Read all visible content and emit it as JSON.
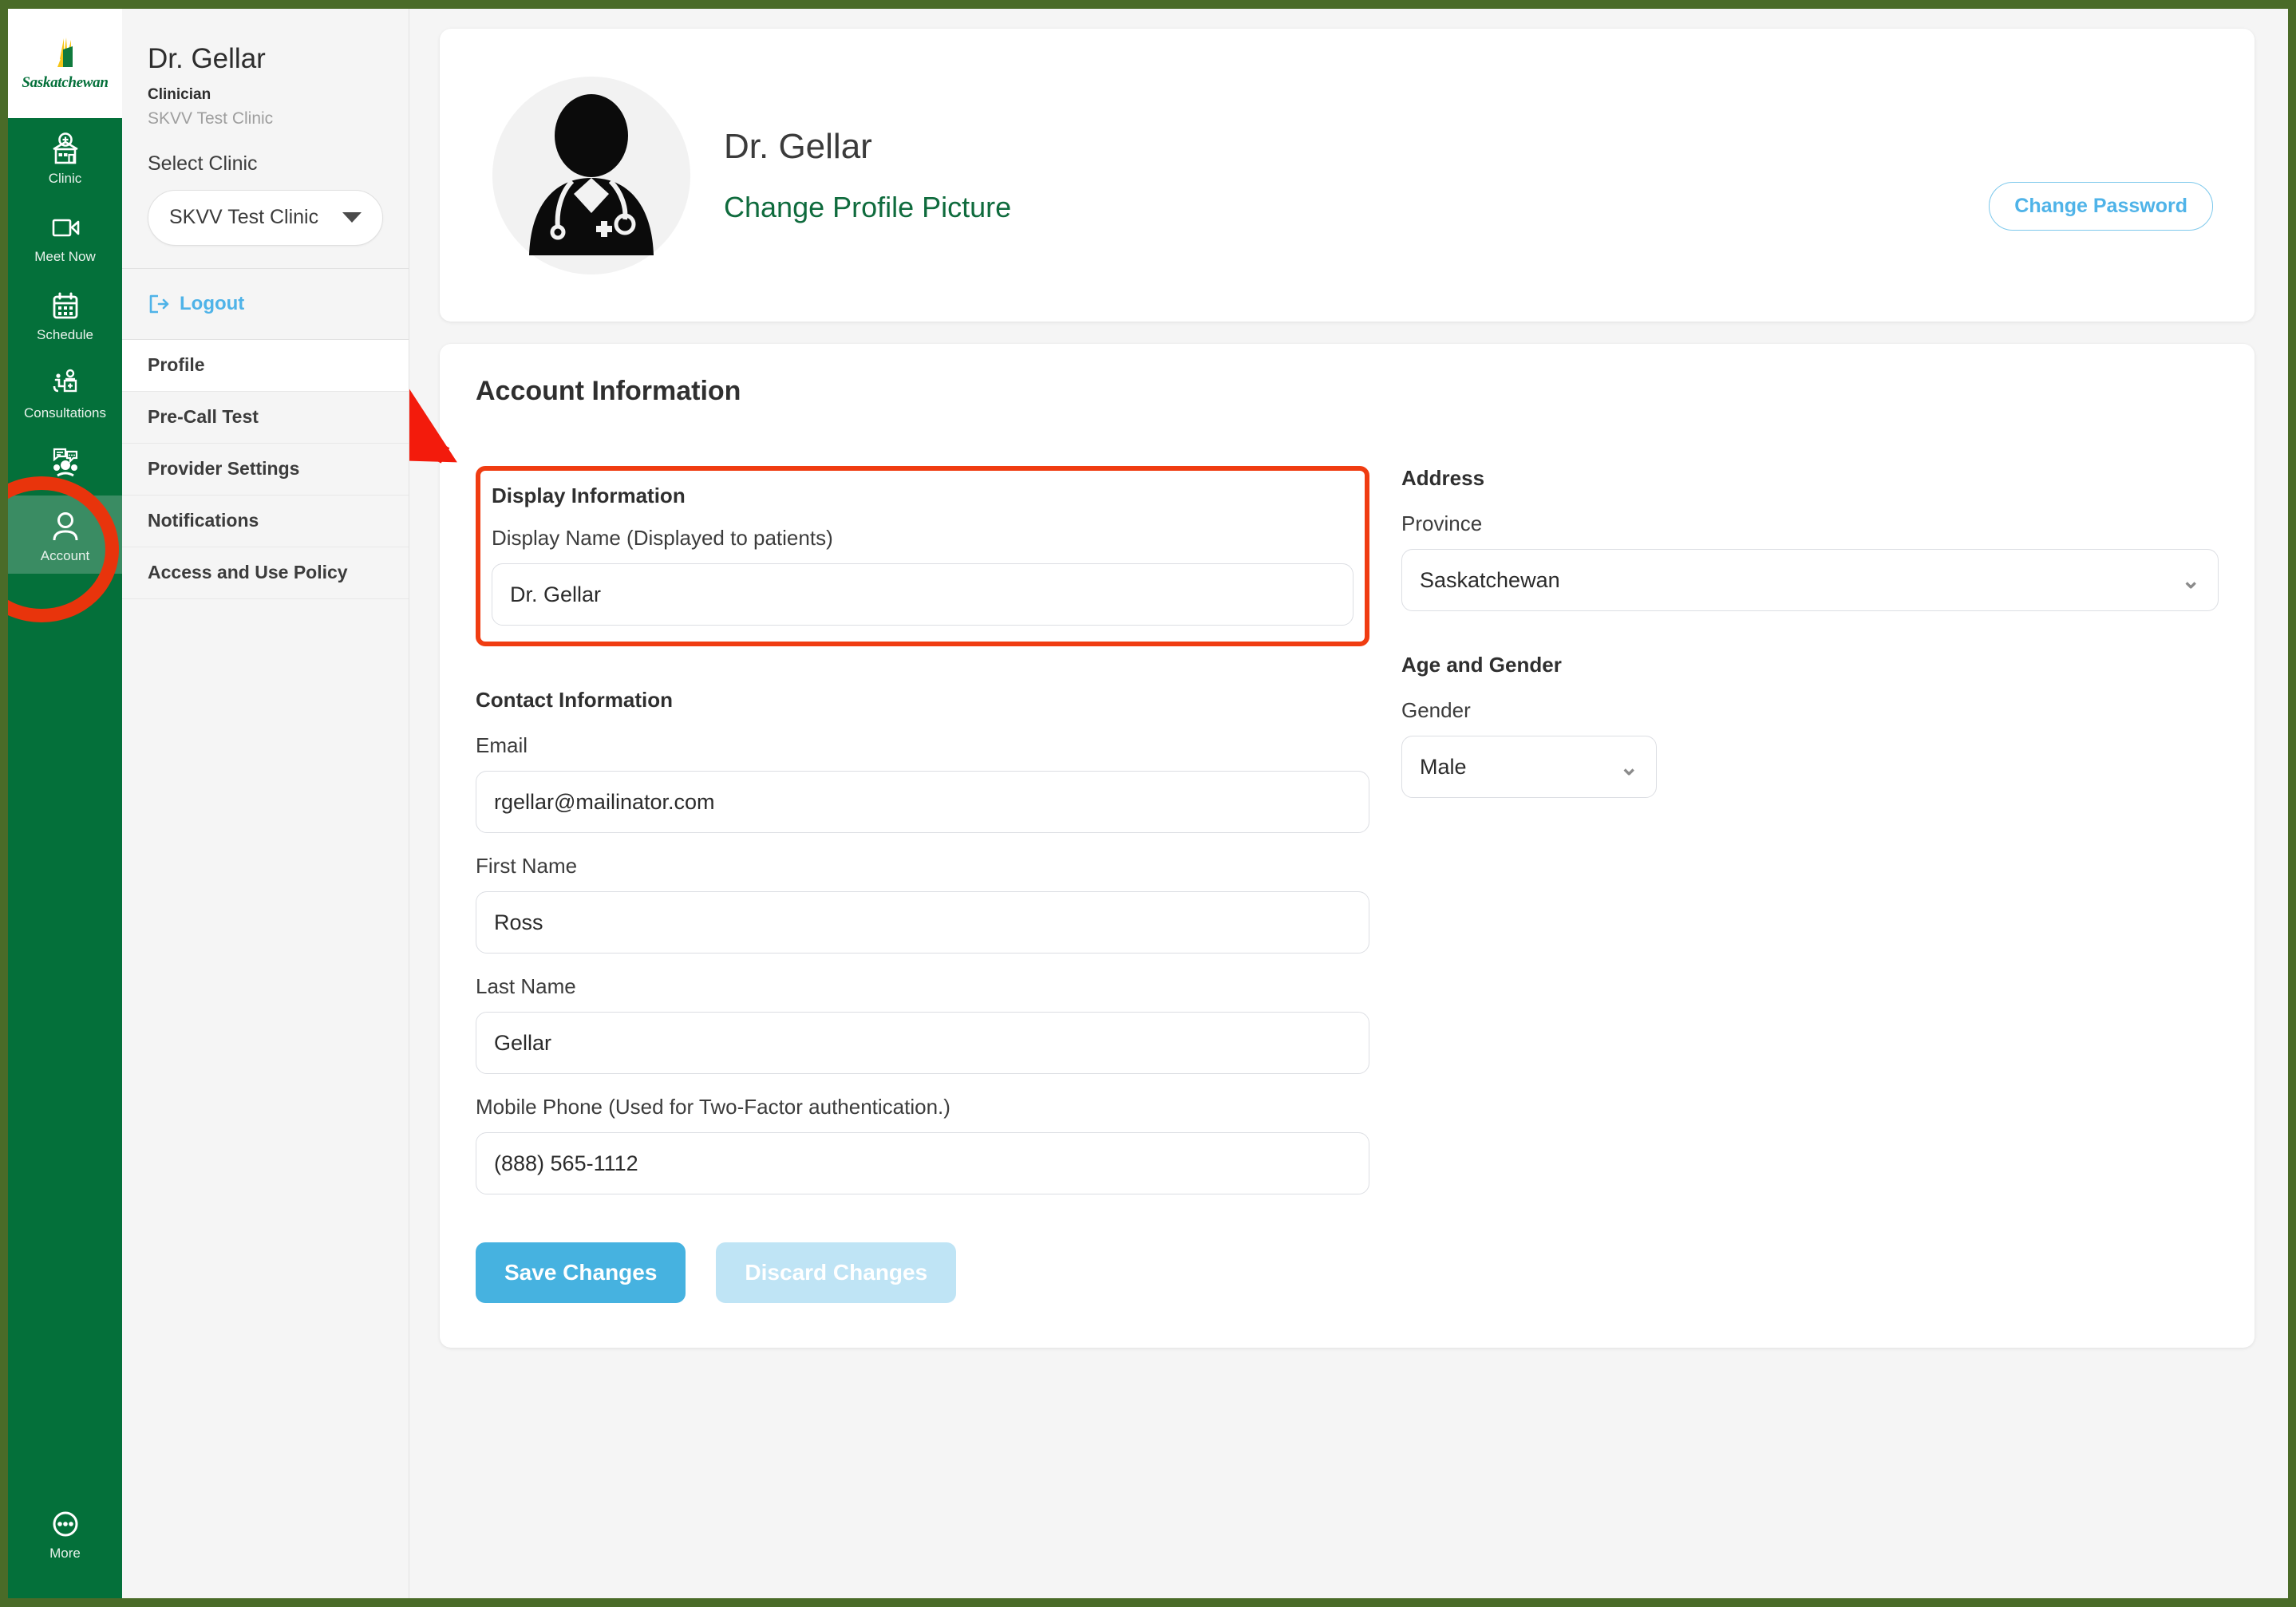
{
  "window": {
    "border_color": "#4a6b28",
    "page_bg": "#f5f5f5"
  },
  "brand": {
    "logo_word": "Saskatchewan",
    "green": "#04703a",
    "logo_icon": "saskatchewan-wheat-logo"
  },
  "rail": {
    "items": [
      {
        "label": "Clinic",
        "icon": "clinic-building-icon",
        "active": false
      },
      {
        "label": "Meet Now",
        "icon": "video-camera-icon",
        "active": false
      },
      {
        "label": "Schedule",
        "icon": "calendar-icon",
        "active": false
      },
      {
        "label": "Consultations",
        "icon": "consultation-desk-icon",
        "active": false
      },
      {
        "label": "",
        "icon": "group-chat-icon",
        "active": false
      },
      {
        "label": "Account",
        "icon": "user-person-icon",
        "active": true
      }
    ],
    "bottom": {
      "label": "More",
      "icon": "more-ellipsis-icon"
    }
  },
  "subnav": {
    "account_name": "Dr. Gellar",
    "role": "Clinician",
    "clinic": "SKVV Test Clinic",
    "select_clinic_label": "Select Clinic",
    "clinic_selected": "SKVV Test Clinic",
    "clinic_options": [
      "SKVV Test Clinic"
    ],
    "logout_label": "Logout",
    "logout_icon": "logout-arrow-icon",
    "menu": [
      {
        "label": "Profile",
        "current": true
      },
      {
        "label": "Pre-Call Test",
        "current": false
      },
      {
        "label": "Provider Settings",
        "current": false
      },
      {
        "label": "Notifications",
        "current": false
      },
      {
        "label": "Access and Use Policy",
        "current": false
      }
    ]
  },
  "profile_card": {
    "name": "Dr. Gellar",
    "change_picture_label": "Change Profile Picture",
    "change_picture_color": "#0f6b3d",
    "avatar_icon": "doctor-avatar-icon",
    "change_password_label": "Change Password",
    "change_password_color": "#4fb3e8"
  },
  "account_information": {
    "title": "Account Information",
    "display_information": {
      "heading": "Display Information",
      "display_name_label": "Display Name (Displayed to patients)",
      "display_name_value": "Dr. Gellar",
      "highlight_color": "#f03c11"
    },
    "address": {
      "heading": "Address",
      "province_label": "Province",
      "province_value": "Saskatchewan",
      "province_options": [
        "Saskatchewan"
      ]
    },
    "contact_information": {
      "heading": "Contact Information",
      "email_label": "Email",
      "email_value": "rgellar@mailinator.com",
      "first_name_label": "First Name",
      "first_name_value": "Ross",
      "last_name_label": "Last Name",
      "last_name_value": "Gellar",
      "mobile_label": "Mobile Phone (Used for Two-Factor authentication.)",
      "mobile_value": "(888) 565-1112"
    },
    "age_and_gender": {
      "heading": "Age and Gender",
      "gender_label": "Gender",
      "gender_value": "Male",
      "gender_options": [
        "Male"
      ]
    },
    "save_label": "Save Changes",
    "discard_label": "Discard Changes",
    "save_color": "#46b2e0",
    "discard_color": "#bfe4f5"
  },
  "annotations": {
    "arrow_color": "#f31b0c",
    "ellipse_color": "#e8340c",
    "arrow_note": "double-headed arrow from Profile menu item to Display Information box",
    "ellipse_note": "red circle around Account rail item"
  }
}
